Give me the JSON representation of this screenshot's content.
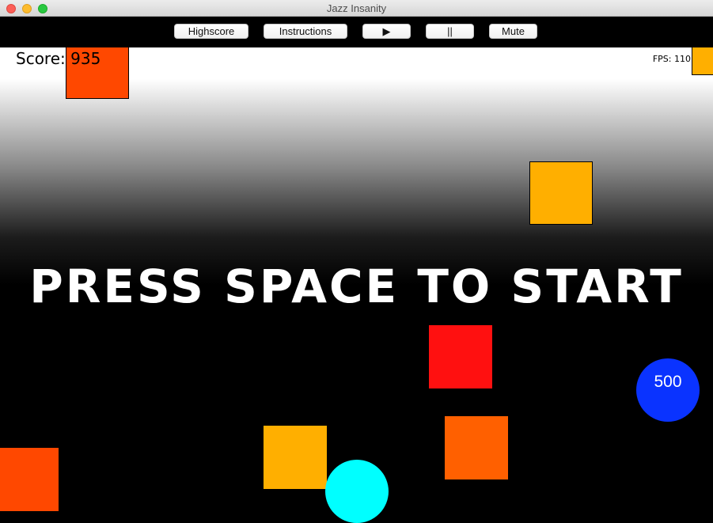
{
  "window": {
    "title": "Jazz Insanity"
  },
  "toolbar": {
    "highscore_label": "Highscore",
    "instructions_label": "Instructions",
    "play_label": "▶",
    "pause_label": "||",
    "mute_label": "Mute"
  },
  "hud": {
    "score_label": "Score:",
    "score_value": "935",
    "fps_label": "FPS: 110"
  },
  "prompt": "PRESS SPACE TO START",
  "bonus": {
    "value": "500",
    "color": "#0a33ff"
  },
  "colors": {
    "orange_red": "#ff4800",
    "amber": "#ffaf00",
    "red": "#ff1010",
    "dark_orange": "#ff6000",
    "cyan": "#00ffff",
    "background": "#000000"
  }
}
